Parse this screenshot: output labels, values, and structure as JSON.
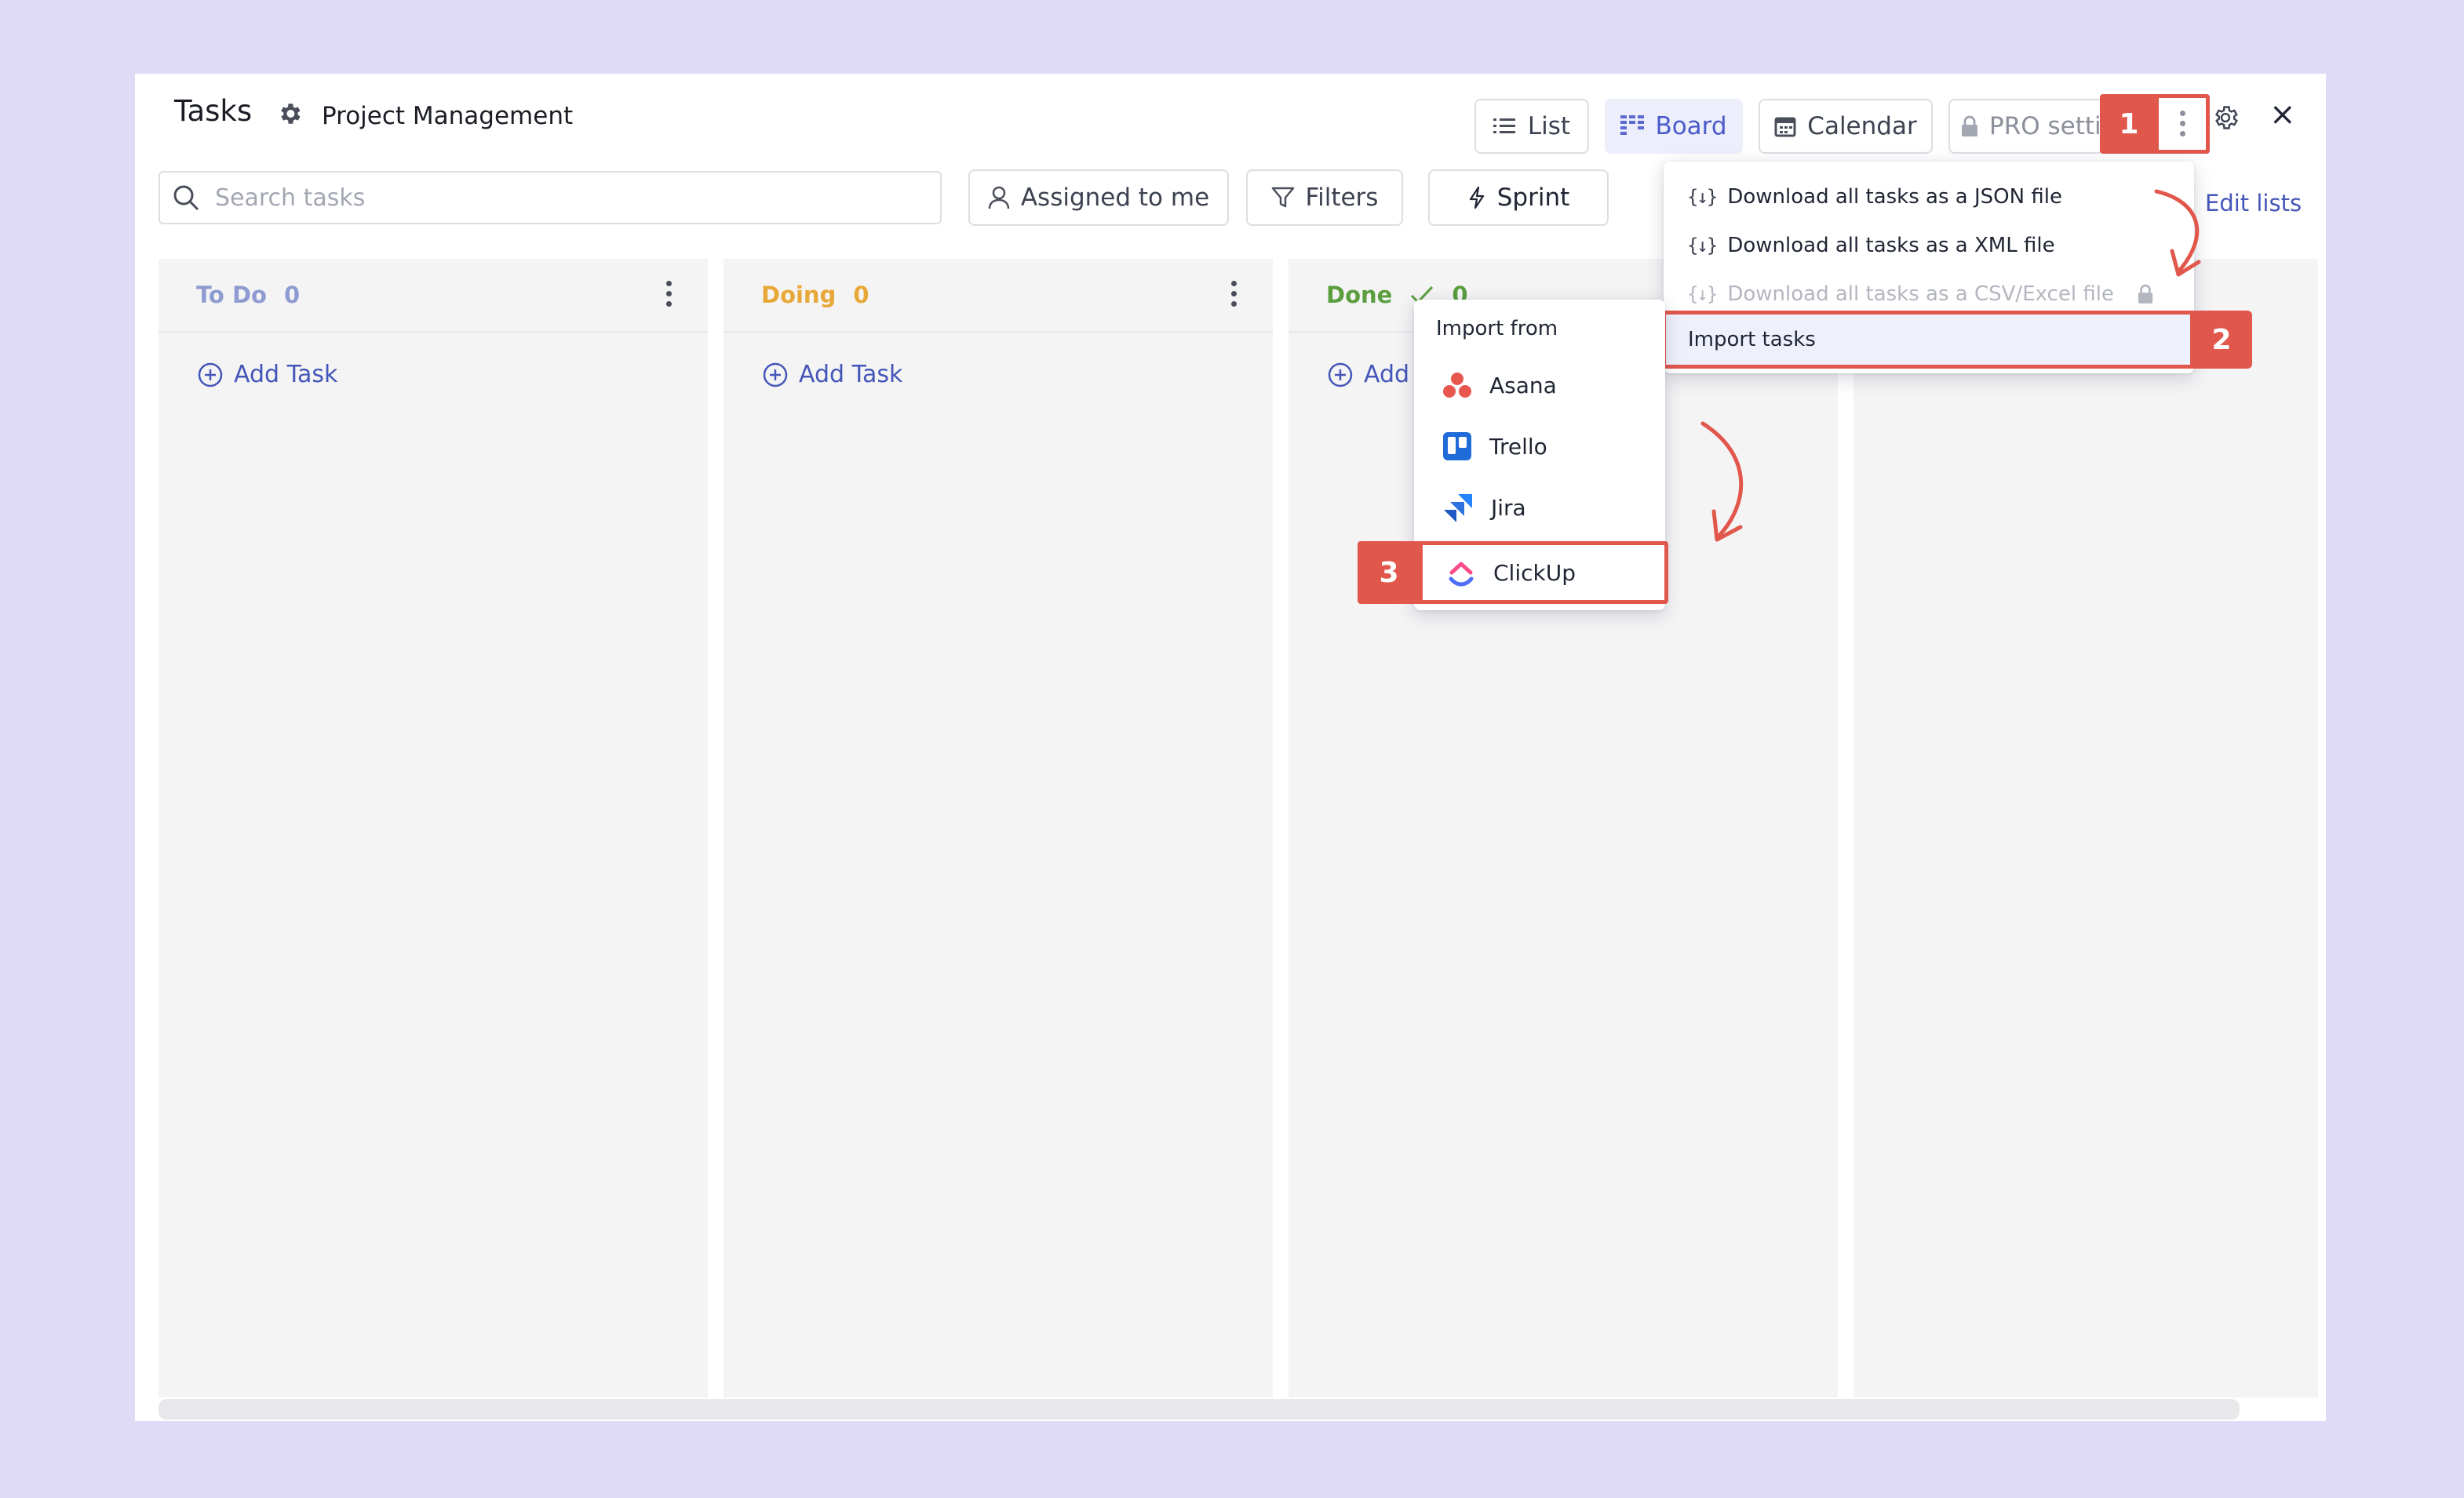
{
  "header": {
    "title": "Tasks",
    "project": "Project Management",
    "views": [
      {
        "label": "List",
        "icon": "list-icon"
      },
      {
        "label": "Board",
        "icon": "board-icon",
        "active": true
      },
      {
        "label": "Calendar",
        "icon": "calendar-icon"
      },
      {
        "label": "PRO settin",
        "icon": "lock-icon"
      }
    ],
    "close_glyph": "×",
    "settings_icon": "gear-icon"
  },
  "toolbar": {
    "search_placeholder": "Search tasks",
    "assigned_label": "Assigned to me",
    "filters_label": "Filters",
    "sprint_label": "Sprint",
    "edit_lists_label": "Edit lists"
  },
  "columns": [
    {
      "name": "To Do",
      "count": "0",
      "color": "#8e9bd0",
      "add_label": "Add Task"
    },
    {
      "name": "Doing",
      "count": "0",
      "color": "#e8a837",
      "add_label": "Add Task"
    },
    {
      "name": "Done",
      "count": "0",
      "color": "#5a9e3e",
      "add_label": "Add"
    }
  ],
  "more_menu": {
    "items": [
      {
        "label": "Download all tasks as a JSON file",
        "icon_text": "{↓}"
      },
      {
        "label": "Download all tasks as a XML file",
        "icon_text": "{↓}"
      },
      {
        "label": "Download all tasks as a CSV/Excel file",
        "icon_text": "{↓}",
        "disabled": true
      },
      {
        "label": "Import tasks",
        "highlighted": true
      }
    ]
  },
  "import_menu": {
    "heading": "Import from",
    "items": [
      {
        "label": "Asana",
        "icon": "asana-icon"
      },
      {
        "label": "Trello",
        "icon": "trello-icon"
      },
      {
        "label": "Jira",
        "icon": "jira-icon"
      },
      {
        "label": "ClickUp",
        "icon": "clickup-icon"
      }
    ]
  },
  "annotations": {
    "step1": "1",
    "step2": "2",
    "step3": "3",
    "accent": "#e2574c"
  },
  "colors": {
    "background": "#dfdbf7",
    "column_bg": "#f4f4f5",
    "link": "#4456b8"
  }
}
